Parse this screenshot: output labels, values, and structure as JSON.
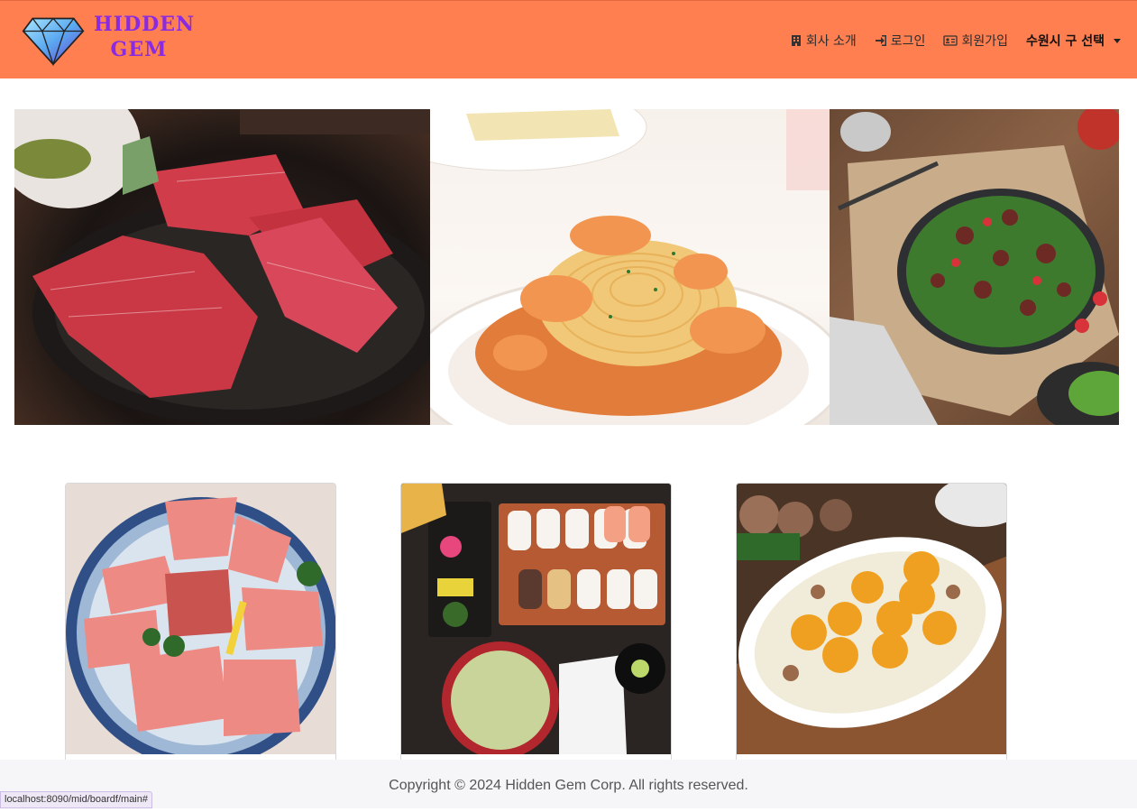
{
  "brand": {
    "line1": "HIDDEN",
    "line2": "GEM",
    "logo_icon": "diamond-icon",
    "colors": {
      "navbar": "#ff7f50",
      "brand_text": "#8a2be2"
    }
  },
  "nav": {
    "about": {
      "label": "회사 소개",
      "icon": "building-icon"
    },
    "login": {
      "label": "로그인",
      "icon": "sign-in-icon"
    },
    "signup": {
      "label": "회원가입",
      "icon": "id-card-icon"
    },
    "city_select": {
      "label": "수원시 구 선택"
    }
  },
  "hero": {
    "slides": [
      "galbi-meat",
      "shrimp-pasta",
      "beef-salad"
    ]
  },
  "cards": [
    {
      "image": "tuna-sashimi"
    },
    {
      "image": "sushi-bento"
    },
    {
      "image": "scallop-dish"
    }
  ],
  "footer": {
    "text": "Copyright © 2024 Hidden Gem Corp. All rights reserved."
  },
  "status_url": "localhost:8090/mid/boardf/main#"
}
